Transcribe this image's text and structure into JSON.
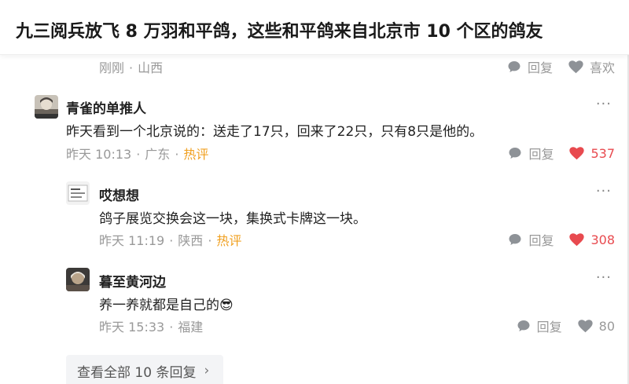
{
  "article_title": "九三阅兵放飞 8 万羽和平鸽，这些和平鸽来自北京市 10 个区的鸽友",
  "top_reply": {
    "time": "刚刚",
    "location": "山西",
    "reply_label": "回复",
    "like_label": "喜欢"
  },
  "comments": [
    {
      "author": "青雀的单推人",
      "text": "昨天看到一个北京说的：送走了17只，回来了22只，只有8只是他的。",
      "time": "昨天 10:13",
      "location": "广东",
      "tag": "热评",
      "reply_label": "回复",
      "likes": "537"
    },
    {
      "author": "哎想想",
      "text": "鸽子展览交换会这一块，集换式卡牌这一块。",
      "time": "昨天 11:19",
      "location": "陕西",
      "tag": "热评",
      "reply_label": "回复",
      "likes": "308"
    },
    {
      "author": "暮至黄河边",
      "text": "养一养就都是自己的😎",
      "time": "昨天 15:33",
      "location": "福建",
      "reply_label": "回复",
      "likes": "80"
    }
  ],
  "more_symbol": "···",
  "separator": "·",
  "view_all": {
    "label": "查看全部 10 条回复",
    "chevron": "›"
  },
  "colors": {
    "hot_tag": "#f0a020",
    "liked_heart": "#e84a4f",
    "meta_gray": "#999999"
  }
}
